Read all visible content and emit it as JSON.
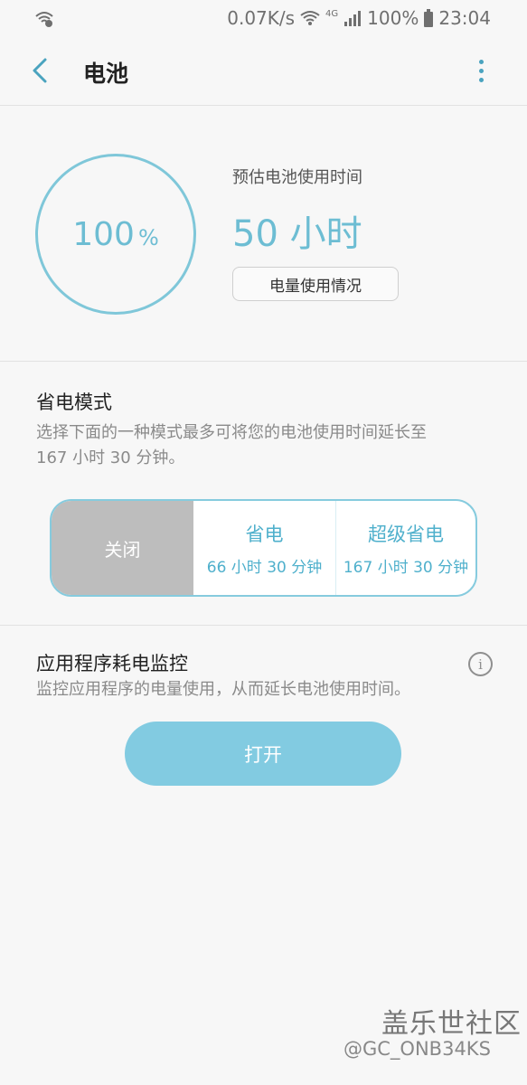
{
  "status_bar": {
    "network_speed": "0.07K/s",
    "network_type": "4G",
    "battery": "100%",
    "time": "23:04"
  },
  "header": {
    "title": "电池"
  },
  "battery": {
    "level": "100",
    "unit": "%",
    "level_fraction": 1.0,
    "estimate_label": "预估电池使用时间",
    "estimate_value": "50 小时",
    "usage_button": "电量使用情况"
  },
  "power_saving": {
    "title": "省电模式",
    "description_line1": "选择下面的一种模式最多可将您的电池使用时间延长至",
    "description_line2": "167 小时 30 分钟。",
    "modes": [
      {
        "label": "关闭",
        "sub": ""
      },
      {
        "label": "省电",
        "sub": "66 小时 30 分钟"
      },
      {
        "label": "超级省电",
        "sub": "167 小时 30 分钟"
      }
    ],
    "selected": "关闭"
  },
  "app_monitor": {
    "title": "应用程序耗电监控",
    "description": "监控应用程序的电量使用，从而延长电池使用时间。",
    "info_glyph": "i",
    "button": "打开"
  },
  "watermark": {
    "logo": "盖乐世社区",
    "user": "@GC_ONB34KS"
  },
  "colors": {
    "accent": "#6dbdd3",
    "button": "#82cbe1",
    "selected_mode": "#bdbdbd"
  }
}
